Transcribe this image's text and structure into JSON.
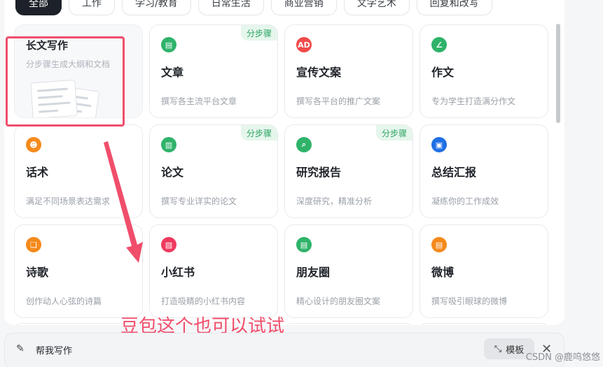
{
  "tabs": [
    "全部",
    "工作",
    "学习/教育",
    "日常生活",
    "商业营销",
    "文学艺术",
    "回复和改写"
  ],
  "feature_card": {
    "title": "长文写作",
    "desc": "分步骤生成大纲和文档"
  },
  "cards": [
    {
      "icon": "document-icon",
      "icon_glyph": "▤",
      "color": "#2fb36a",
      "title": "文章",
      "desc": "撰写各主流平台文章",
      "badge": "分步骤"
    },
    {
      "icon": "ad-icon",
      "icon_glyph": "AD",
      "color": "#f04a4a",
      "title": "宣传文案",
      "desc": "撰写各平台的推广文案",
      "badge": ""
    },
    {
      "icon": "pen-icon",
      "icon_glyph": "∠",
      "color": "#2fb36a",
      "title": "作文",
      "desc": "专为学生打造满分作文",
      "badge": ""
    },
    {
      "icon": "speech-icon",
      "icon_glyph": "☻",
      "color": "#f58a1c",
      "title": "话术",
      "desc": "满足不同场景表达需求",
      "badge": ""
    },
    {
      "icon": "bar-chart-icon",
      "icon_glyph": "▥",
      "color": "#2fb36a",
      "title": "论文",
      "desc": "撰写专业详实的论文",
      "badge": "分步骤"
    },
    {
      "icon": "research-icon",
      "icon_glyph": "⌕",
      "color": "#2fb36a",
      "title": "研究报告",
      "desc": "深度研究，精准分析",
      "badge": "分步骤"
    },
    {
      "icon": "summary-icon",
      "icon_glyph": "▣",
      "color": "#1f6fe5",
      "title": "总结汇报",
      "desc": "凝练你的工作成效",
      "badge": ""
    },
    {
      "icon": "poem-icon",
      "icon_glyph": "❏",
      "color": "#f58a1c",
      "title": "诗歌",
      "desc": "创作动人心弦的诗篇",
      "badge": ""
    },
    {
      "icon": "image-icon",
      "icon_glyph": "▨",
      "color": "#f03a5f",
      "title": "小红书",
      "desc": "打造吸睛的小红书内容",
      "badge": ""
    },
    {
      "icon": "moments-icon",
      "icon_glyph": "▤",
      "color": "#2fb36a",
      "title": "朋友圈",
      "desc": "精心设计的朋友圈文案",
      "badge": ""
    },
    {
      "icon": "weibo-icon",
      "icon_glyph": "▤",
      "color": "#f58a1c",
      "title": "微博",
      "desc": "撰写吸引眼球的微博",
      "badge": ""
    }
  ],
  "annotation": {
    "text": "豆包这个也可以试试",
    "color": "#f04e6b"
  },
  "bottom_bar": {
    "label": "帮我写作",
    "template_label": "模板",
    "close_glyph": "✕"
  },
  "watermark": "CSDN @鹿呜悠悠"
}
